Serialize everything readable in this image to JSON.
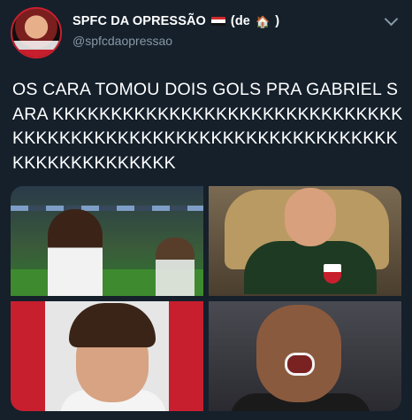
{
  "tweet": {
    "author": {
      "display_name": "SPFC DA OPRESSÃO",
      "name_suffix": "(de",
      "house_emoji": "🏠",
      "name_close": ")",
      "handle": "@spfcdaopressao"
    },
    "text": "OS CARA TOMOU DOIS GOLS PRA GABRIEL SARA KKKKKKKKKKKKKKKKKKKKKKKKKKKKKKKKKKKKKKKKKKKKKKKKKKKKKKKKKKKKKKKKKKKKKKKKKKKKK",
    "media": [
      {
        "name": "photo-player-celebrating"
      },
      {
        "name": "photo-goalkeeper-laughing"
      },
      {
        "name": "photo-young-player-smiling"
      },
      {
        "name": "photo-man-laughing"
      }
    ]
  },
  "colors": {
    "background": "#15202b",
    "text_primary": "#ffffff",
    "text_secondary": "#8899a6",
    "club_red": "#c81f2e"
  }
}
